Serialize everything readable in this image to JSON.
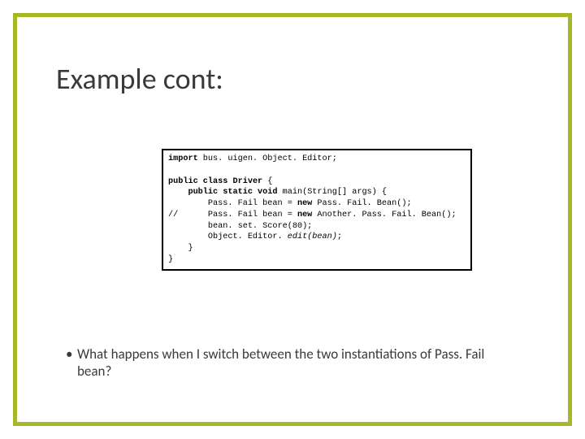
{
  "title": "Example cont:",
  "code": {
    "l1a": "import ",
    "l1b": "bus. uigen. Object. Editor;",
    "l2a": "public class ",
    "l2b": "Driver",
    "l2c": " {",
    "l3a": "    public static void ",
    "l3b": "main(String[] args) {",
    "l4a": "        Pass. Fail bean = ",
    "l4b": "new ",
    "l4c": "Pass. Fail. Bean();",
    "l5a": "//      Pass. Fail bean = ",
    "l5b": "new ",
    "l5c": "Another. Pass. Fail. Bean();",
    "l6": "        bean. set. Score(80);",
    "l7a": "        Object. Editor. ",
    "l7b": "edit(bean)",
    "l7c": ";",
    "l8": "    }",
    "l9": "}"
  },
  "bullet": {
    "marker": "•",
    "text": "What happens when I switch between the two instantiations of Pass. Fail bean?"
  }
}
